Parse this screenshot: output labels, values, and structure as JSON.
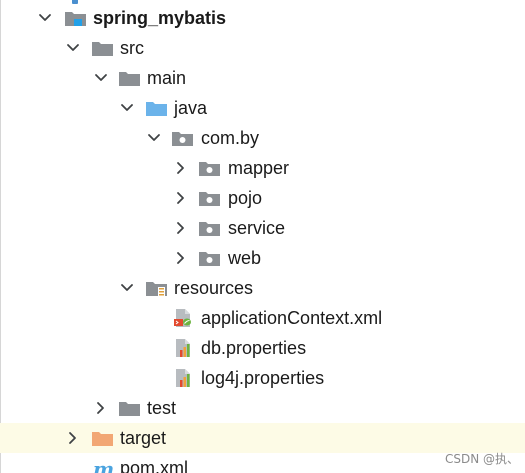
{
  "project_tree": {
    "root": "spring_mybatis",
    "src": "src",
    "main": "main",
    "java": "java",
    "package": "com.by",
    "mapper": "mapper",
    "pojo": "pojo",
    "service": "service",
    "web": "web",
    "resources": "resources",
    "application_context": "applicationContext.xml",
    "db_properties": "db.properties",
    "log4j_properties": "log4j.properties",
    "test": "test",
    "target": "target",
    "pom": "pom.xml"
  },
  "watermark": "CSDN @执、",
  "colors": {
    "folder": "#8b8f93",
    "java_folder": "#6bb3ea",
    "target_folder": "#f2a774",
    "highlight": "#fdfbe6",
    "selection_marker": "#4a8fcf"
  }
}
